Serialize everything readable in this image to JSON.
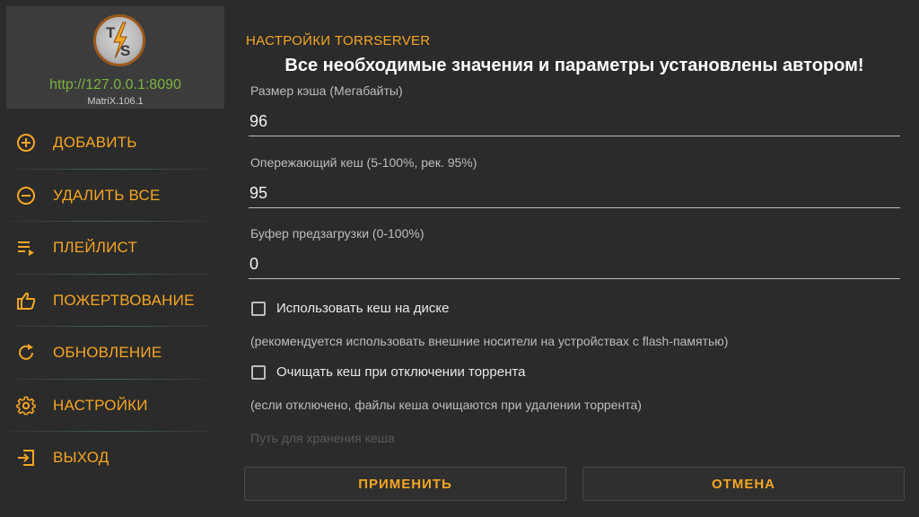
{
  "sidebar": {
    "logo_letters": "TS",
    "server_url": "http://127.0.0.1:8090",
    "server_version": "MatriX.106.1",
    "items": [
      {
        "label": "ДОБАВИТЬ",
        "icon": "plus-circle-icon"
      },
      {
        "label": "УДАЛИТЬ ВСЕ",
        "icon": "minus-circle-icon"
      },
      {
        "label": "ПЛЕЙЛИСТ",
        "icon": "playlist-icon"
      },
      {
        "label": "ПОЖЕРТВОВАНИЕ",
        "icon": "thumbs-up-icon"
      },
      {
        "label": "ОБНОВЛЕНИЕ",
        "icon": "refresh-icon"
      },
      {
        "label": "НАСТРОЙКИ",
        "icon": "gear-icon"
      },
      {
        "label": "ВЫХОД",
        "icon": "exit-icon"
      }
    ]
  },
  "main": {
    "title": "НАСТРОЙКИ TORRSERVER",
    "banner": "Все необходимые значения и параметры установлены автором!",
    "fields": [
      {
        "label": "Размер кэша (Мегабайты)",
        "value": "96"
      },
      {
        "label": "Опережающий кеш (5-100%, рек. 95%)",
        "value": "95"
      },
      {
        "label": "Буфер предзагрузки (0-100%)",
        "value": "0"
      }
    ],
    "checkboxes": [
      {
        "label": "Использовать кеш на диске",
        "hint": "(рекомендуется использовать внешние носители на устройствах с flash-памятью)",
        "checked": false
      },
      {
        "label": "Очищать кеш при отключении торрента",
        "hint": "(если отключено, файлы кеша очищаются при удалении торрента)",
        "checked": false
      }
    ],
    "faded_label": "Путь для хранения кеша",
    "apply_label": "ПРИМЕНИТЬ",
    "cancel_label": "ОТМЕНА"
  },
  "colors": {
    "accent": "#f5a623",
    "url_green": "#7cb342",
    "background": "#2b2b2b",
    "card": "#3c3c3c"
  }
}
